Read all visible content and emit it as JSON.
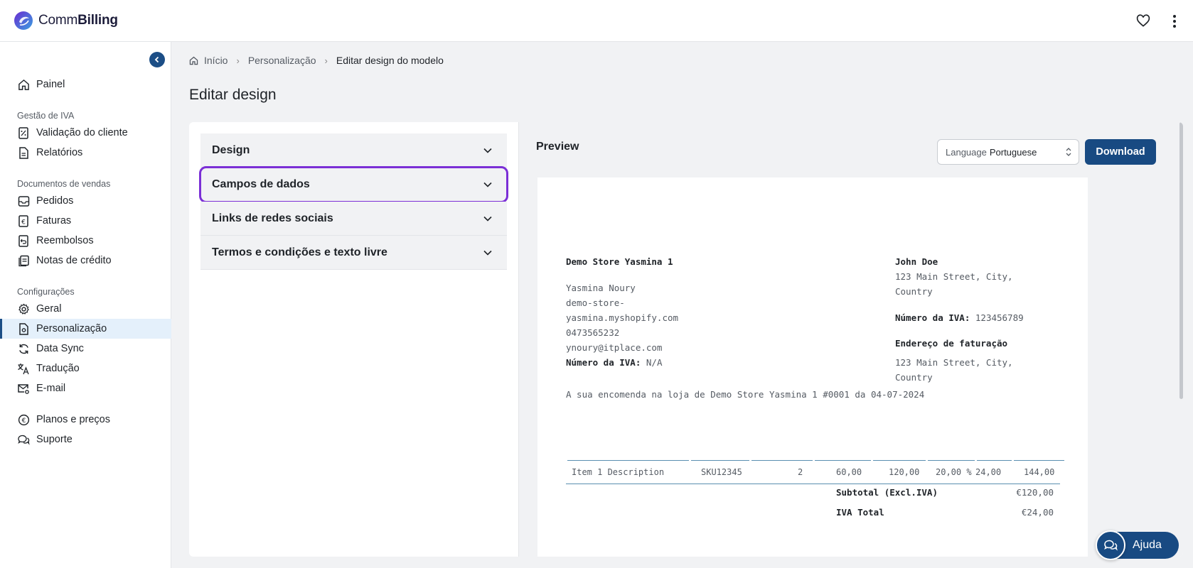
{
  "app": {
    "brand_prefix": "Comm",
    "brand_suffix": "Billing"
  },
  "sidebar": {
    "groups": [
      {
        "heading": "",
        "items": [
          {
            "label": "Painel",
            "icon": "home-icon"
          }
        ]
      },
      {
        "heading": "Gestão de IVA",
        "items": [
          {
            "label": "Validação do cliente",
            "icon": "percent-document-icon"
          },
          {
            "label": "Relatórios",
            "icon": "document-icon"
          }
        ]
      },
      {
        "heading": "Documentos de vendas",
        "items": [
          {
            "label": "Pedidos",
            "icon": "inbox-icon"
          },
          {
            "label": "Faturas",
            "icon": "euro-document-icon"
          },
          {
            "label": "Reembolsos",
            "icon": "refund-icon"
          },
          {
            "label": "Notas de crédito",
            "icon": "notes-icon"
          }
        ]
      },
      {
        "heading": "Configurações",
        "items": [
          {
            "label": "Geral",
            "icon": "gear-icon"
          },
          {
            "label": "Personalização",
            "icon": "customize-icon",
            "active": true
          },
          {
            "label": "Data Sync",
            "icon": "sync-icon"
          },
          {
            "label": "Tradução",
            "icon": "translate-icon"
          },
          {
            "label": "E-mail",
            "icon": "mail-settings-icon"
          }
        ]
      },
      {
        "heading": "",
        "items": [
          {
            "label": "Planos e preços",
            "icon": "euro-circle-icon"
          },
          {
            "label": "Suporte",
            "icon": "chat-icon"
          }
        ]
      }
    ]
  },
  "breadcrumb": {
    "home": "Início",
    "section": "Personalização",
    "current": "Editar design do modelo"
  },
  "page": {
    "title": "Editar design"
  },
  "accordion": {
    "items": [
      {
        "label": "Design"
      },
      {
        "label": "Campos de dados",
        "highlighted": true
      },
      {
        "label": "Links de redes sociais"
      },
      {
        "label": "Termos e condições e texto livre"
      }
    ]
  },
  "preview": {
    "title": "Preview",
    "language_label": "Language",
    "language_value": "Portuguese",
    "download_label": "Download"
  },
  "invoice": {
    "store_name": "Demo Store Yasmina 1",
    "store_lines": [
      "Yasmina Noury",
      "demo-store-",
      "yasmina.myshopify.com",
      "0473565232",
      "ynoury@itplace.com"
    ],
    "vat_label": "Número da IVA:",
    "store_vat": "N/A",
    "customer_name": "John Doe",
    "customer_address_1": "123 Main Street, City,",
    "customer_address_2": "Country",
    "customer_vat": "123456789",
    "billing_label": "Endereço de faturação",
    "billing_address_1": "123 Main Street, City,",
    "billing_address_2": "Country",
    "order_text": "A sua encomenda na loja de Demo Store Yasmina 1 #0001 da 04-07-2024",
    "line_item": {
      "description": "Item 1 Description",
      "sku": "SKU12345",
      "qty": "2",
      "unit_price": "60,00",
      "net": "120,00",
      "vat_rate": "20,00 %",
      "vat_amount": "24,00",
      "total": "144,00"
    },
    "subtotal_label": "Subtotal (Excl.IVA)",
    "subtotal_value": "€120,00",
    "vat_total_label": "IVA Total",
    "vat_total_value": "€24,00"
  },
  "help": {
    "label": "Ajuda"
  },
  "colors": {
    "primary": "#184a82",
    "highlight": "#7b2fd6",
    "active_bg": "#e4f0fb"
  }
}
